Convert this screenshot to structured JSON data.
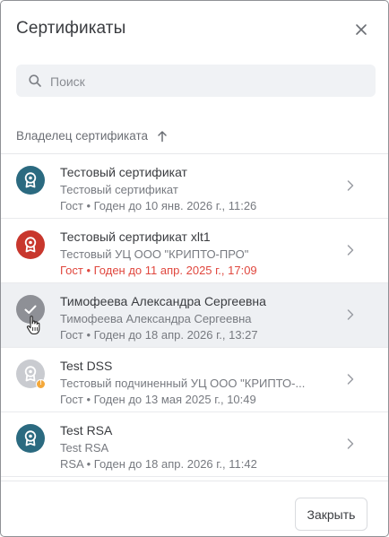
{
  "dialog": {
    "title": "Сертификаты",
    "close_icon": "close-icon"
  },
  "search": {
    "placeholder": "Поиск",
    "value": "",
    "icon": "search-icon"
  },
  "list_header": {
    "column_label": "Владелец сертификата",
    "sort_icon": "arrow-up-icon"
  },
  "certificates": [
    {
      "name": "Тестовый сертификат",
      "issuer": "Тестовый сертификат",
      "validity": "Гост • Годен до 10 янв. 2026 г., 11:26",
      "status": "valid",
      "avatar_color": "#2b6a80",
      "icon": "certificate-icon"
    },
    {
      "name": "Тестовый сертификат xlt1",
      "issuer": "Тестовый УЦ ООО \"КРИПТО-ПРО\"",
      "validity": "Гост • Годен до 11 апр. 2025 г., 17:09",
      "status": "expired",
      "avatar_color": "#c8372d",
      "icon": "certificate-icon"
    },
    {
      "name": "Тимофеева Александра Сергеевна",
      "issuer": "Тимофеева Александра Сергеевна",
      "validity": "Гост • Годен до 18 апр. 2026 г., 13:27",
      "status": "selected",
      "avatar_color": "#8e9096",
      "icon": "checkmark-icon"
    },
    {
      "name": "Test DSS",
      "issuer": "Тестовый подчиненный УЦ ООО \"КРИПТО-...",
      "validity": "Гост • Годен до 13 мая 2025 г., 10:49",
      "status": "warning",
      "avatar_color": "#c9cbd0",
      "icon": "certificate-icon"
    },
    {
      "name": "Test RSA",
      "issuer": "Test RSA",
      "validity": "RSA • Годен до 18 апр. 2026 г., 11:42",
      "status": "valid",
      "avatar_color": "#2b6a80",
      "icon": "certificate-icon"
    }
  ],
  "footer": {
    "close_label": "Закрыть"
  },
  "colors": {
    "accent_teal": "#2b6a80",
    "expired_red": "#e0473e",
    "warning_orange": "#f4a83a"
  }
}
